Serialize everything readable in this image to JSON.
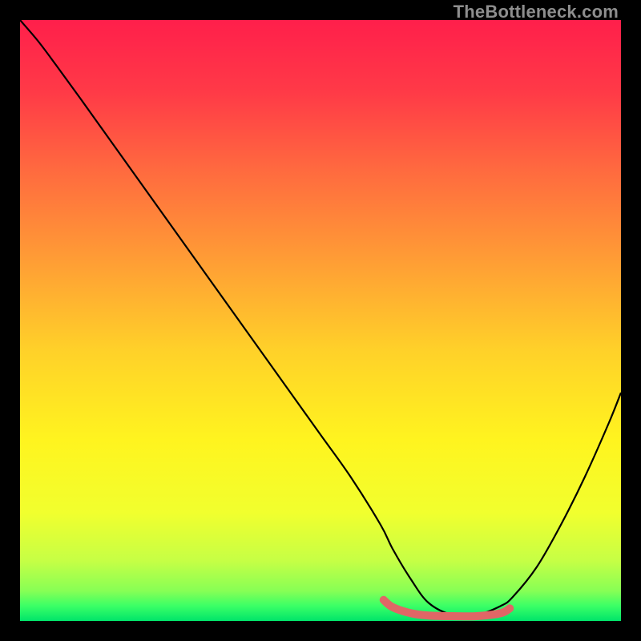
{
  "watermark": "TheBottleneck.com",
  "chart_data": {
    "type": "line",
    "title": "",
    "xlabel": "",
    "ylabel": "",
    "xlim": [
      0,
      100
    ],
    "ylim": [
      0,
      100
    ],
    "series": [
      {
        "name": "curve",
        "color": "#000000",
        "x": [
          0,
          3,
          6,
          10,
          15,
          20,
          25,
          30,
          35,
          40,
          45,
          50,
          55,
          60,
          62,
          65,
          68,
          72,
          76,
          80,
          82,
          86,
          90,
          94,
          98,
          100
        ],
        "y": [
          100,
          96.5,
          92.5,
          87,
          80,
          73,
          66,
          59,
          52,
          45,
          38,
          31,
          24,
          16,
          12,
          7,
          3,
          1,
          1,
          2.5,
          4,
          9,
          16,
          24,
          33,
          38
        ]
      },
      {
        "name": "optimal-zone",
        "color": "#e06666",
        "x": [
          60.5,
          62,
          65,
          68,
          72,
          76,
          80,
          81.5
        ],
        "y": [
          3.5,
          2.3,
          1.3,
          0.9,
          0.8,
          0.8,
          1.3,
          2.1
        ]
      }
    ],
    "gradient_stops": [
      {
        "offset": 0.0,
        "color": "#ff1f4b"
      },
      {
        "offset": 0.12,
        "color": "#ff3a47"
      },
      {
        "offset": 0.25,
        "color": "#ff6a3f"
      },
      {
        "offset": 0.4,
        "color": "#ff9d35"
      },
      {
        "offset": 0.55,
        "color": "#ffd129"
      },
      {
        "offset": 0.7,
        "color": "#fff41f"
      },
      {
        "offset": 0.82,
        "color": "#f1ff2e"
      },
      {
        "offset": 0.9,
        "color": "#c6ff45"
      },
      {
        "offset": 0.95,
        "color": "#87ff55"
      },
      {
        "offset": 0.975,
        "color": "#3bff66"
      },
      {
        "offset": 1.0,
        "color": "#00e46a"
      }
    ]
  }
}
